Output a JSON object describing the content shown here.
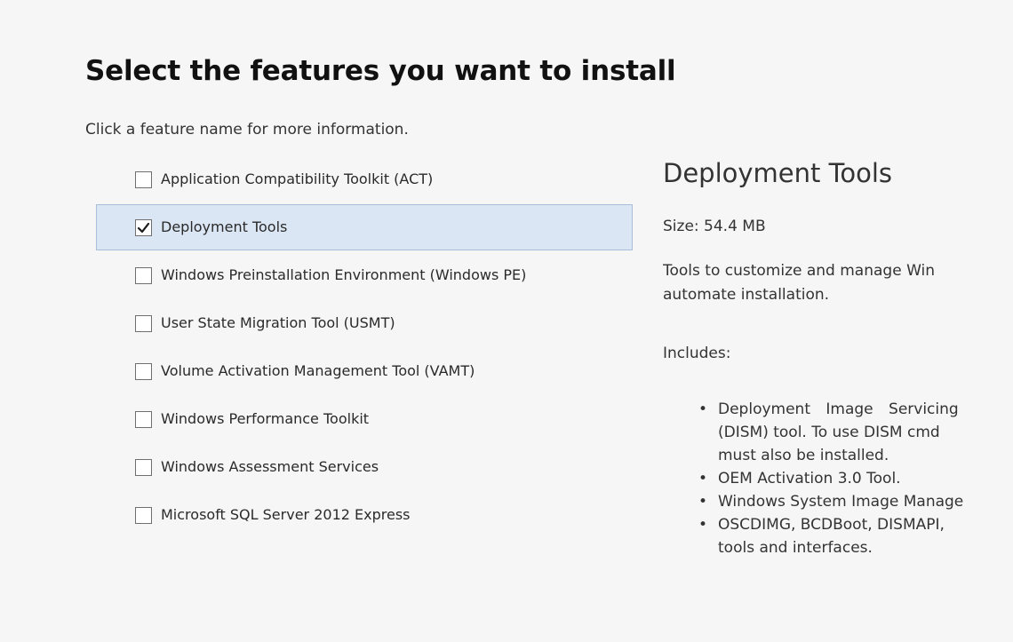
{
  "header": {
    "title": "Select the features you want to install",
    "subtitle": "Click a feature name for more information."
  },
  "features": [
    {
      "label": "Application Compatibility Toolkit (ACT)",
      "checked": false,
      "selected": false
    },
    {
      "label": "Deployment Tools",
      "checked": true,
      "selected": true
    },
    {
      "label": "Windows Preinstallation Environment (Windows PE)",
      "checked": false,
      "selected": false
    },
    {
      "label": "User State Migration Tool (USMT)",
      "checked": false,
      "selected": false
    },
    {
      "label": "Volume Activation Management Tool (VAMT)",
      "checked": false,
      "selected": false
    },
    {
      "label": "Windows Performance Toolkit",
      "checked": false,
      "selected": false
    },
    {
      "label": "Windows Assessment Services",
      "checked": false,
      "selected": false
    },
    {
      "label": "Microsoft SQL Server 2012 Express",
      "checked": false,
      "selected": false
    }
  ],
  "details": {
    "title": "Deployment Tools",
    "size": "Size: 54.4 MB",
    "description_lines": [
      "Tools to customize and manage Win",
      "automate installation."
    ],
    "includes_label": "Includes:",
    "includes": [
      {
        "lines": [
          "Deployment Image Servicing",
          "(DISM) tool. To use DISM cmd",
          "must also be installed."
        ]
      },
      {
        "lines": [
          "OEM Activation 3.0 Tool."
        ]
      },
      {
        "lines": [
          "Windows System Image Manage"
        ]
      },
      {
        "lines": [
          "OSCDIMG, BCDBoot, DISMAPI,",
          "tools and interfaces."
        ]
      }
    ]
  },
  "colors": {
    "background": "#f6f6f6",
    "selected_row": "#dbe6f4",
    "selected_border": "#a9bfd9"
  }
}
